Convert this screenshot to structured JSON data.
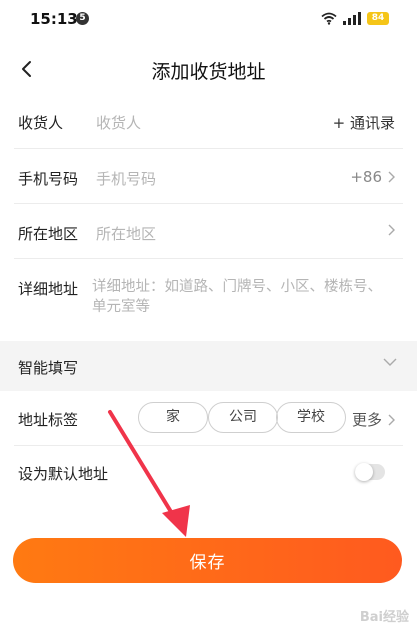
{
  "status_bar": {
    "time": "15:13",
    "notification_count": "5",
    "battery": "84"
  },
  "nav": {
    "title": "添加收货地址"
  },
  "form": {
    "name": {
      "label": "收货人",
      "placeholder": "收货人",
      "contacts_link": "+ 通讯录"
    },
    "phone": {
      "label": "手机号码",
      "placeholder": "手机号码",
      "country_code": "+86"
    },
    "region": {
      "label": "所在地区",
      "placeholder": "所在地区"
    },
    "detail": {
      "label": "详细地址",
      "placeholder": "详细地址：如道路、门牌号、小区、楼栋号、单元室等"
    }
  },
  "smart_fill": {
    "label": "智能填写"
  },
  "tags": {
    "label": "地址标签",
    "options": [
      "家",
      "公司",
      "学校"
    ],
    "more": "更多"
  },
  "default_address": {
    "label": "设为默认地址",
    "enabled": false
  },
  "save_button": {
    "label": "保存"
  },
  "watermark": "Bai经验",
  "colors": {
    "accent": "#ff6a18",
    "annotation_arrow": "#f0344a"
  }
}
